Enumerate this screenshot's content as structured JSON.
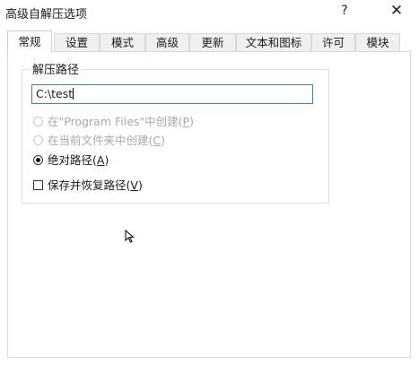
{
  "window": {
    "title": "高级自解压选项",
    "help_glyph": "?",
    "close_glyph": "✕"
  },
  "tabs": [
    {
      "label": "常规",
      "active": true
    },
    {
      "label": "设置",
      "active": false
    },
    {
      "label": "模式",
      "active": false
    },
    {
      "label": "高级",
      "active": false
    },
    {
      "label": "更新",
      "active": false
    },
    {
      "label": "文本和图标",
      "active": false
    },
    {
      "label": "许可",
      "active": false
    },
    {
      "label": "模块",
      "active": false
    }
  ],
  "extract_path": {
    "group_title": "解压路径",
    "value": "C:\\test",
    "options": [
      {
        "label": "在\"Program Files\"中创建(",
        "hotkey": "P",
        "suffix": ")",
        "checked": false,
        "enabled": false
      },
      {
        "label": "在当前文件夹中创建(",
        "hotkey": "C",
        "suffix": ")",
        "checked": false,
        "enabled": false
      },
      {
        "label": "绝对路径(",
        "hotkey": "A",
        "suffix": ")",
        "checked": true,
        "enabled": true
      }
    ],
    "save_restore": {
      "label": "保存并恢复路径(",
      "hotkey": "V",
      "suffix": ")",
      "checked": false
    }
  },
  "colors": {
    "input_border": "#3c7fd6",
    "disabled_text": "#a8a8a8"
  },
  "icons": {
    "mouse_cursor": "arrow-cursor-icon"
  }
}
